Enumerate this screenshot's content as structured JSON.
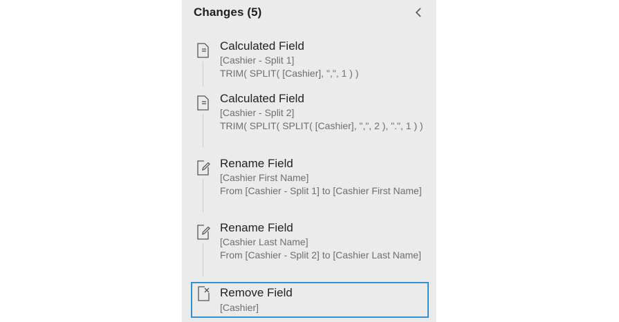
{
  "panel": {
    "title": "Changes (5)",
    "collapse_icon": "chevron-left-icon",
    "accent_color": "#2f8fd3",
    "background": "#ebebeb"
  },
  "changes": [
    {
      "icon": "calculated-field-icon",
      "title": "Calculated Field",
      "field": "[Cashier - Split 1]",
      "detail": "TRIM( SPLIT( [Cashier], \",\", 1 ) )"
    },
    {
      "icon": "calculated-field-icon",
      "title": "Calculated Field",
      "field": "[Cashier - Split 2]",
      "detail": "TRIM( SPLIT( SPLIT( [Cashier], \",\", 2 ), \".\", 1 ) )"
    },
    {
      "icon": "rename-field-icon",
      "title": "Rename Field",
      "field": "[Cashier First Name]",
      "detail": "From [Cashier - Split 1] to [Cashier First Name]"
    },
    {
      "icon": "rename-field-icon",
      "title": "Rename Field",
      "field": "[Cashier Last Name]",
      "detail": "From [Cashier - Split 2] to [Cashier Last Name]"
    },
    {
      "icon": "remove-field-icon",
      "title": "Remove Field",
      "field": "[Cashier]",
      "detail": "",
      "selected": true
    }
  ]
}
